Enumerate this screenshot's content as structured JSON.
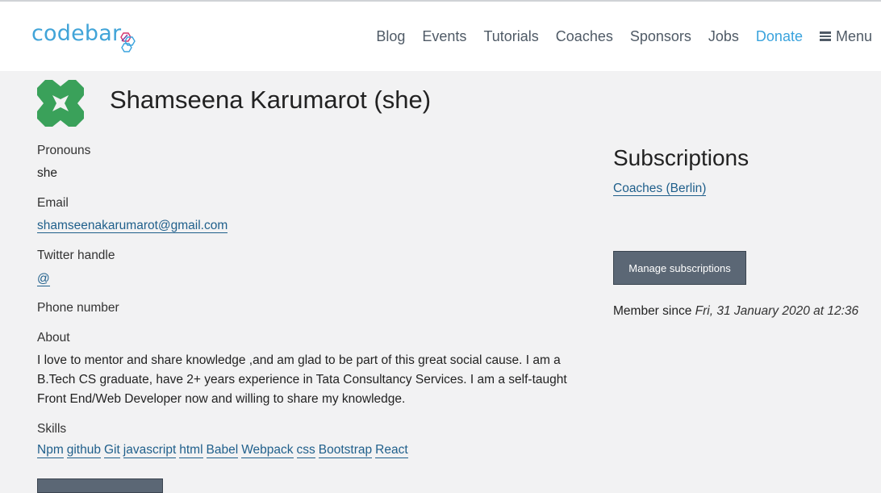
{
  "header": {
    "logo_text": "codebar",
    "nav": [
      {
        "label": "Blog"
      },
      {
        "label": "Events"
      },
      {
        "label": "Tutorials"
      },
      {
        "label": "Coaches"
      },
      {
        "label": "Sponsors"
      },
      {
        "label": "Jobs"
      },
      {
        "label": "Donate"
      }
    ],
    "menu_label": "Menu"
  },
  "profile": {
    "name": "Shamseena Karumarot (she)",
    "avatar_color": "#3aa15a",
    "pronouns_label": "Pronouns",
    "pronouns": "she",
    "email_label": "Email",
    "email": "shamseenakarumarot@gmail.com",
    "twitter_label": "Twitter handle",
    "twitter": "@",
    "phone_label": "Phone number",
    "about_label": "About",
    "about": "I love to mentor and share knowledge ,and am glad to be part of this great social cause. I am a B.Tech CS graduate, have 2+ years experience in Tata Consultancy Services. I am a self-taught Front End/Web Developer now and willing to share my knowledge.",
    "skills_label": "Skills",
    "skills": [
      "Npm",
      "github",
      "Git",
      "javascript",
      "html",
      "Babel",
      "Webpack",
      "css",
      "Bootstrap",
      "React"
    ]
  },
  "subscriptions": {
    "title": "Subscriptions",
    "item": "Coaches (Berlin)",
    "manage_button": "Manage subscriptions",
    "member_since_label": "Member since",
    "member_since_date": "Fri, 31 January 2020 at 12:36"
  },
  "colors": {
    "brand": "#41a4d8",
    "donate": "#3aa3dd",
    "button_bg": "#5b6775",
    "link": "#1f5f8b"
  }
}
